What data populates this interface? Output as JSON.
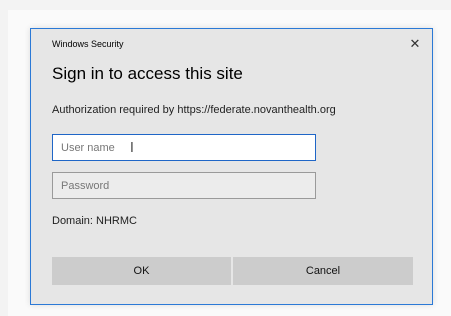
{
  "dialog": {
    "window_title": "Windows Security",
    "close_glyph": "✕",
    "heading": "Sign in to access this site",
    "auth_message": "Authorization required by https://federate.novanthealth.org",
    "username_placeholder": "User name",
    "password_placeholder": "Password",
    "domain_label": "Domain: NHRMC",
    "ok_label": "OK",
    "cancel_label": "Cancel",
    "accent_color": "#2b79d6"
  }
}
